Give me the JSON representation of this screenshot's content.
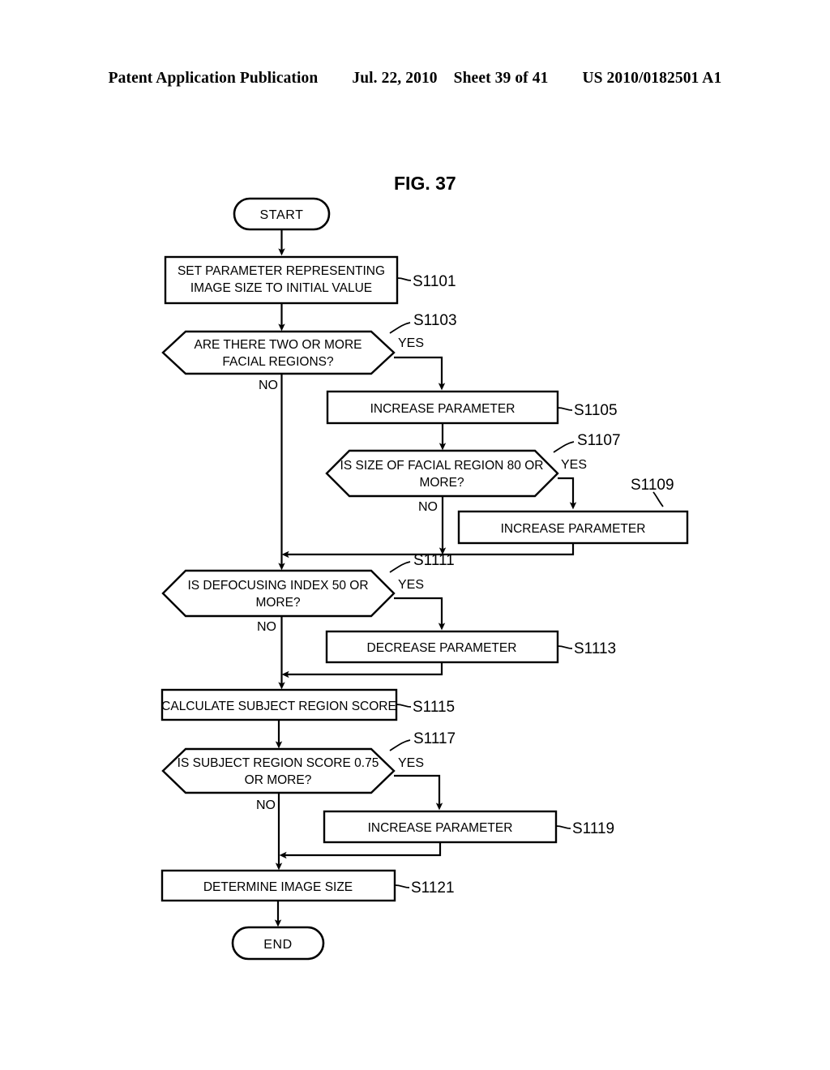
{
  "header": {
    "publication": "Patent Application Publication",
    "date": "Jul. 22, 2010",
    "sheet": "Sheet 39 of 41",
    "patent_number": "US 2010/0182501 A1"
  },
  "figure": {
    "title": "FIG. 37"
  },
  "flowchart": {
    "start_label": "START",
    "end_label": "END",
    "yes_label": "YES",
    "no_label": "NO",
    "nodes": [
      {
        "id": "S1101",
        "type": "process",
        "step": "S1101",
        "lines": [
          "SET PARAMETER REPRESENTING",
          "IMAGE SIZE TO INITIAL VALUE"
        ]
      },
      {
        "id": "S1103",
        "type": "decision",
        "step": "S1103",
        "lines": [
          "ARE THERE TWO OR MORE",
          "FACIAL REGIONS?"
        ]
      },
      {
        "id": "S1105",
        "type": "process",
        "step": "S1105",
        "lines": [
          "INCREASE PARAMETER"
        ]
      },
      {
        "id": "S1107",
        "type": "decision",
        "step": "S1107",
        "lines": [
          "IS SIZE OF FACIAL REGION 80 OR",
          "MORE?"
        ]
      },
      {
        "id": "S1109",
        "type": "process",
        "step": "S1109",
        "lines": [
          "INCREASE PARAMETER"
        ]
      },
      {
        "id": "S1111",
        "type": "decision",
        "step": "S1111",
        "lines": [
          "IS DEFOCUSING INDEX 50 OR",
          "MORE?"
        ]
      },
      {
        "id": "S1113",
        "type": "process",
        "step": "S1113",
        "lines": [
          "DECREASE PARAMETER"
        ]
      },
      {
        "id": "S1115",
        "type": "process",
        "step": "S1115",
        "lines": [
          "CALCULATE SUBJECT REGION SCORE"
        ]
      },
      {
        "id": "S1117",
        "type": "decision",
        "step": "S1117",
        "lines": [
          "IS SUBJECT REGION SCORE 0.75",
          "OR MORE?"
        ]
      },
      {
        "id": "S1119",
        "type": "process",
        "step": "S1119",
        "lines": [
          "INCREASE PARAMETER"
        ]
      },
      {
        "id": "S1121",
        "type": "process",
        "step": "S1121",
        "lines": [
          "DETERMINE IMAGE SIZE"
        ]
      }
    ]
  }
}
